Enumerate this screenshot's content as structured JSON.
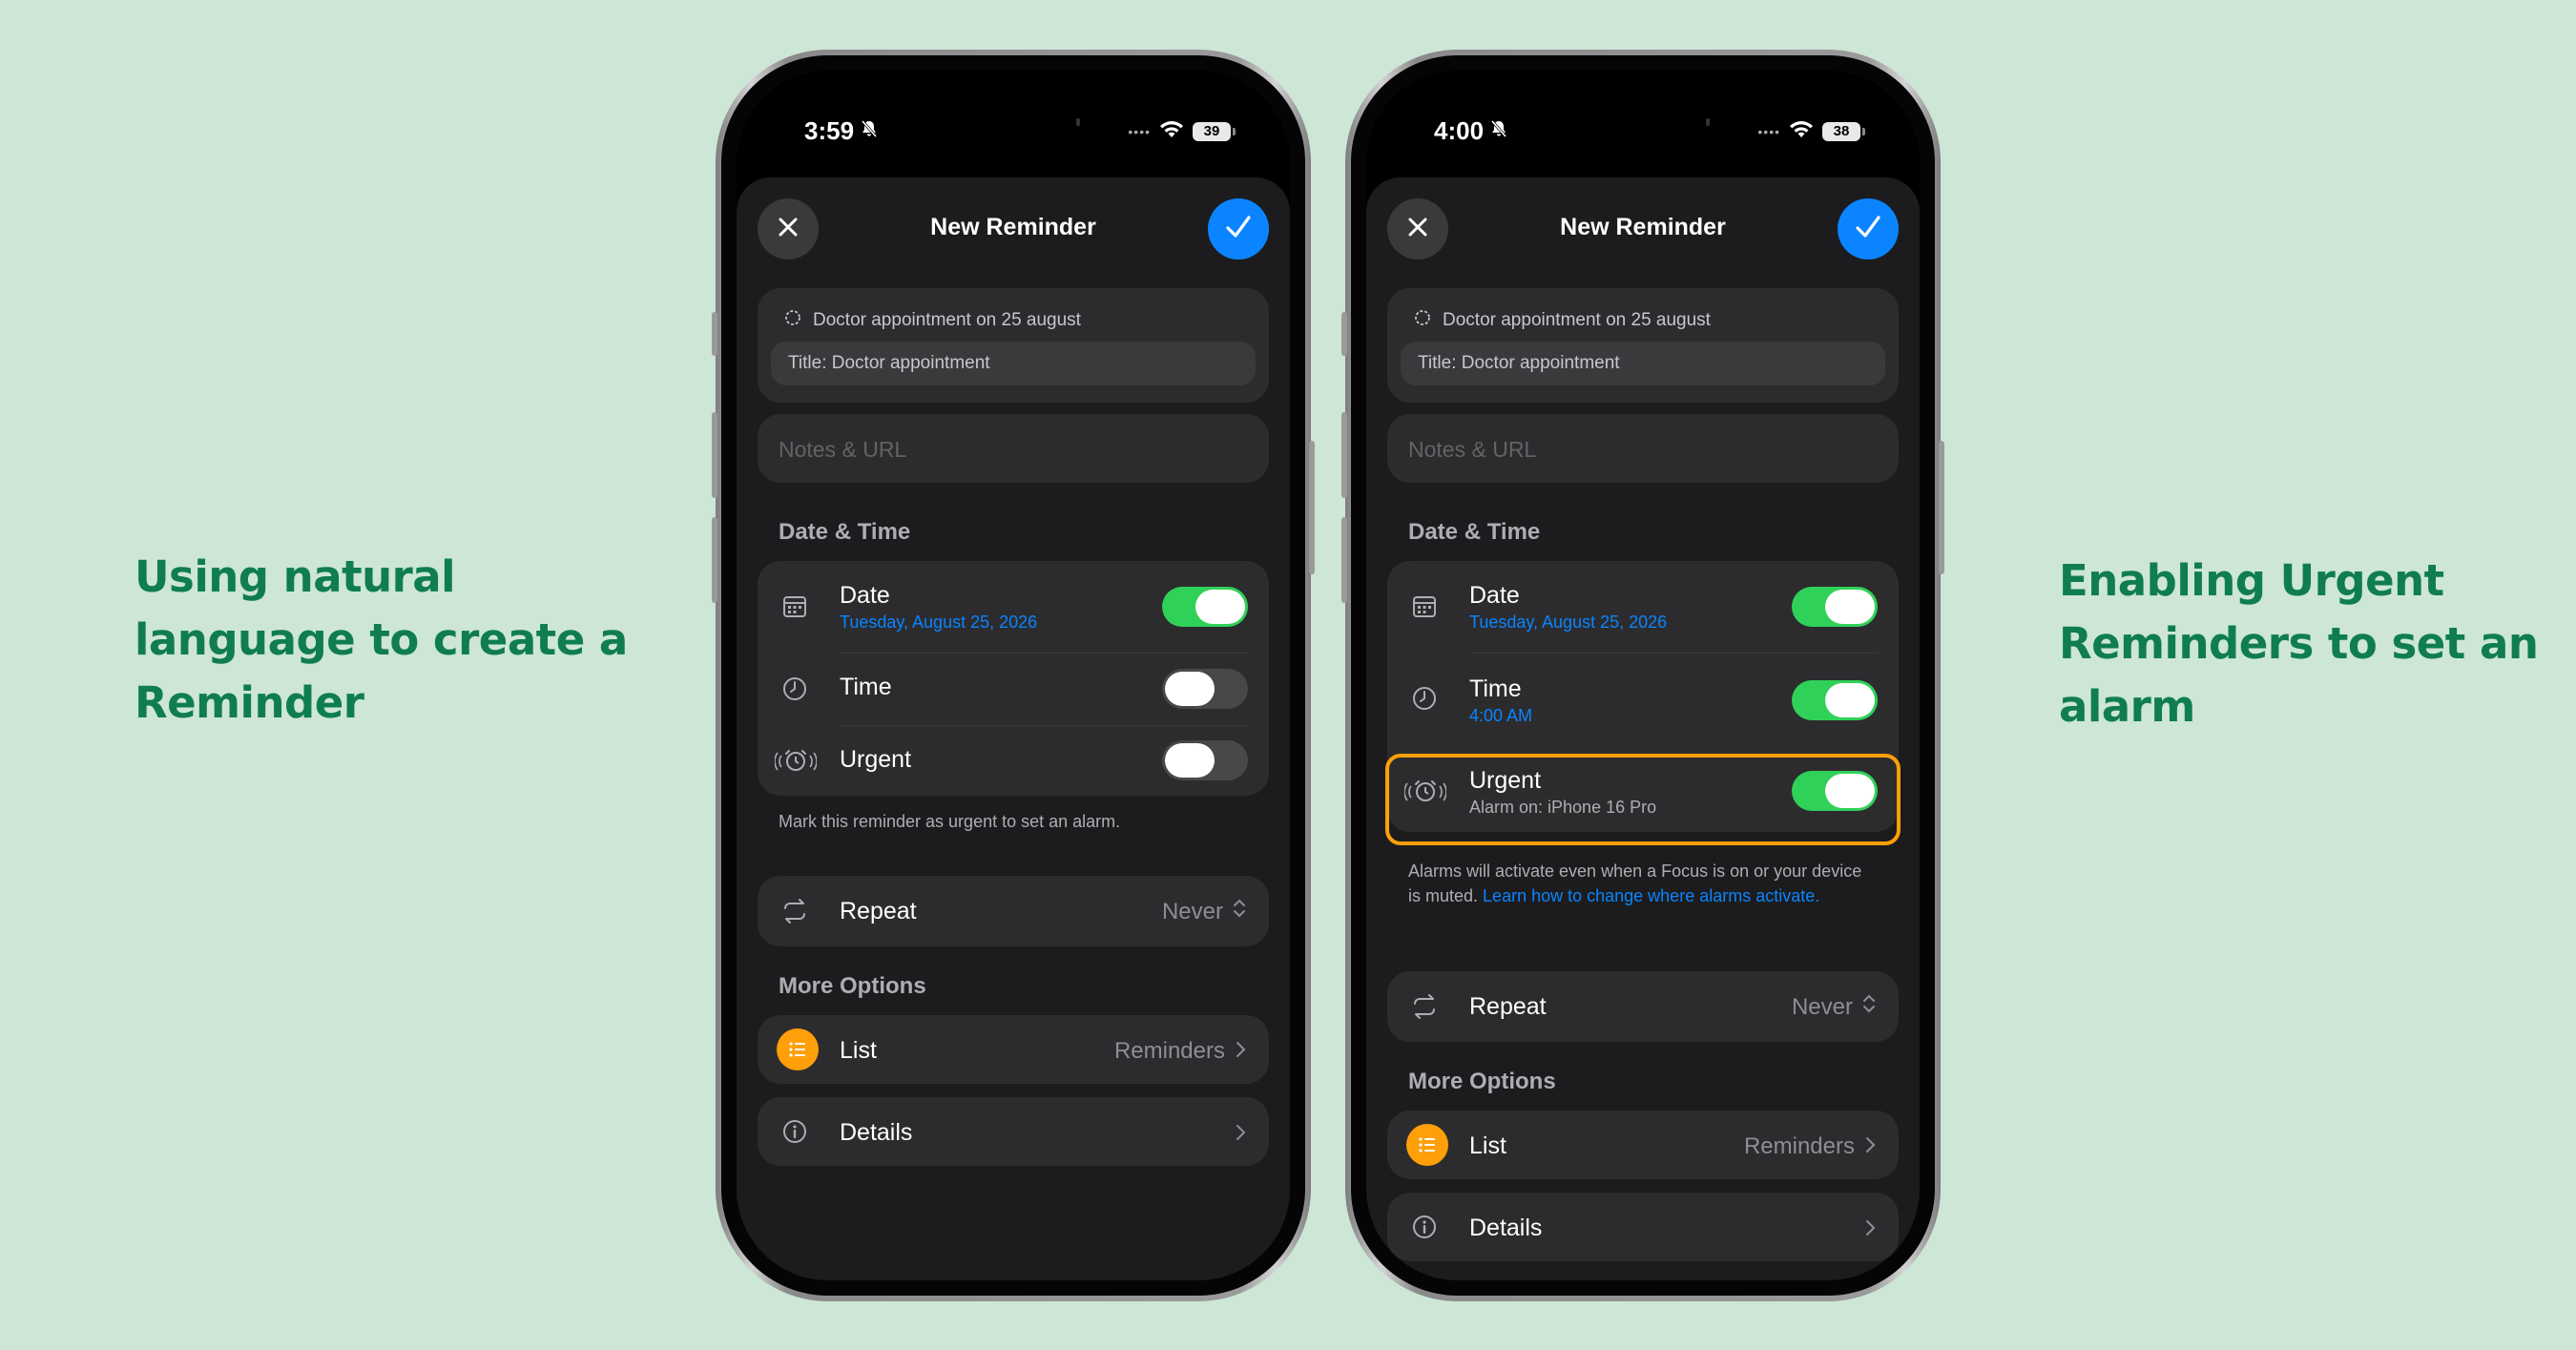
{
  "captions": {
    "left": "Using natural language to create a Reminder",
    "right": "Enabling Urgent Reminders to set an alarm"
  },
  "colors": {
    "background": "#cde6d6",
    "caption": "#0f7d50",
    "accent_blue": "#0a84ff",
    "toggle_on": "#30d158",
    "highlight_orange": "#ff9f0a"
  },
  "phone_left": {
    "status": {
      "time": "3:59",
      "battery": "39"
    },
    "nav": {
      "title": "New Reminder"
    },
    "natural_language": {
      "input": "Doctor appointment on 25 august",
      "parsed_title": "Title: Doctor appointment"
    },
    "notes": {
      "placeholder": "Notes & URL"
    },
    "date_time": {
      "header": "Date & Time",
      "date": {
        "label": "Date",
        "value": "Tuesday, August 25, 2026",
        "enabled": true
      },
      "time": {
        "label": "Time",
        "enabled": false
      },
      "urgent": {
        "label": "Urgent",
        "enabled": false
      },
      "footnote": "Mark this reminder as urgent to set an alarm."
    },
    "repeat": {
      "label": "Repeat",
      "value": "Never"
    },
    "more_options": {
      "header": "More Options",
      "list": {
        "label": "List",
        "value": "Reminders"
      },
      "details": {
        "label": "Details"
      }
    }
  },
  "phone_right": {
    "status": {
      "time": "4:00",
      "battery": "38"
    },
    "nav": {
      "title": "New Reminder"
    },
    "natural_language": {
      "input": "Doctor appointment on 25 august",
      "parsed_title": "Title: Doctor appointment"
    },
    "notes": {
      "placeholder": "Notes & URL"
    },
    "date_time": {
      "header": "Date & Time",
      "date": {
        "label": "Date",
        "value": "Tuesday, August 25, 2026",
        "enabled": true
      },
      "time": {
        "label": "Time",
        "value": "4:00 AM",
        "enabled": true
      },
      "urgent": {
        "label": "Urgent",
        "value": "Alarm on: iPhone 16 Pro",
        "enabled": true
      },
      "footnote": "Alarms will activate even when a Focus is on or your device is muted.",
      "footnote_link": "Learn how to change where alarms activate."
    },
    "repeat": {
      "label": "Repeat",
      "value": "Never"
    },
    "more_options": {
      "header": "More Options",
      "list": {
        "label": "List",
        "value": "Reminders"
      },
      "details": {
        "label": "Details"
      }
    }
  },
  "icons": {
    "close": "close-icon",
    "confirm": "checkmark-icon",
    "sparkle": "sparkle-icon",
    "calendar": "calendar-icon",
    "clock": "clock-icon",
    "alarm": "alarm-icon",
    "repeat": "repeat-icon",
    "list": "list-icon",
    "info": "info-icon",
    "chevron": "chevron-right-icon",
    "updown": "chevron-updown-icon",
    "bell_muted": "bell-slash-icon",
    "wifi": "wifi-icon",
    "battery": "battery-icon"
  }
}
